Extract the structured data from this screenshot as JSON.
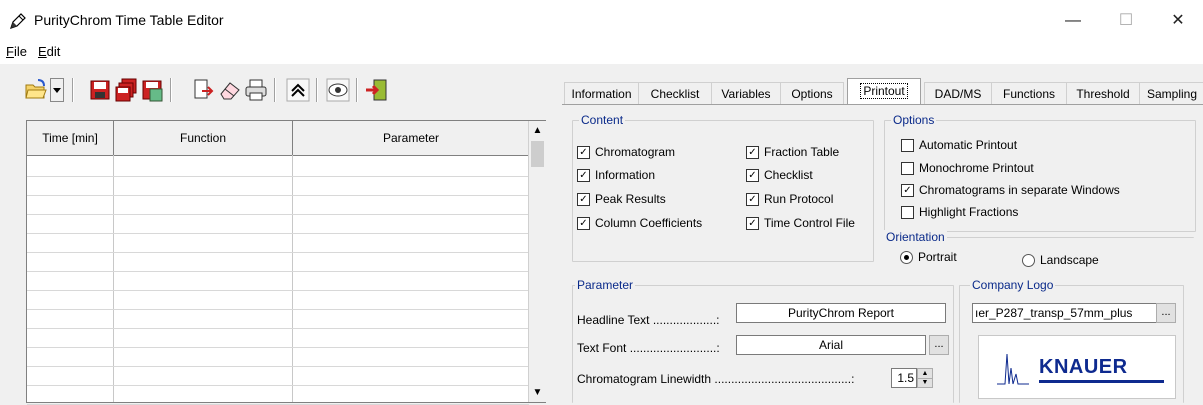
{
  "window": {
    "title": "PurityChrom Time Table Editor",
    "controls": {
      "minimize": "—",
      "maximize": "☐",
      "close": "✕"
    }
  },
  "menu": {
    "file": "File",
    "file_access": "F",
    "file_rest": "ile",
    "edit": "Edit",
    "edit_access": "E",
    "edit_rest": "dit"
  },
  "toolbar": {
    "icons": [
      "open-folder-icon",
      "dropdown-arrow-icon",
      "save-icon",
      "save-all-icon",
      "save-as-icon",
      "import-icon",
      "erase-icon",
      "print-icon",
      "move-up-icon",
      "preview-icon",
      "exit-icon"
    ]
  },
  "table": {
    "columns": [
      "Time [min]",
      "Function",
      "Parameter"
    ],
    "rows": 13
  },
  "tabs": [
    "Information",
    "Checklist",
    "Variables",
    "Options",
    "Printout",
    "DAD/MS",
    "Functions",
    "Threshold",
    "Sampling"
  ],
  "active_tab": "Printout",
  "content": {
    "label": "Content",
    "items": [
      {
        "label": "Chromatogram",
        "checked": true
      },
      {
        "label": "Information",
        "checked": true
      },
      {
        "label": "Peak Results",
        "checked": true
      },
      {
        "label": "Column Coefficients",
        "checked": true
      },
      {
        "label": "Fraction Table",
        "checked": true
      },
      {
        "label": "Checklist",
        "checked": true
      },
      {
        "label": "Run Protocol",
        "checked": true
      },
      {
        "label": "Time Control File",
        "checked": true
      }
    ]
  },
  "options": {
    "label": "Options",
    "items": [
      {
        "label": "Automatic Printout",
        "checked": false
      },
      {
        "label": "Monochrome Printout",
        "checked": false
      },
      {
        "label": "Chromatograms in separate Windows",
        "checked": true
      },
      {
        "label": "Highlight Fractions",
        "checked": false
      }
    ],
    "orientation": {
      "label": "Orientation",
      "portrait": "Portrait",
      "landscape": "Landscape",
      "selected": "Portrait"
    }
  },
  "parameter": {
    "label": "Parameter",
    "headline_label": "Headline Text ...................:",
    "headline_value": "PurityChrom Report",
    "font_label": "Text Font ..........................:",
    "font_value": "Arial",
    "linewidth_label": "Chromatogram Linewidth .........................................:",
    "linewidth_value": "1.5",
    "ellipsis": "..."
  },
  "logo": {
    "label": "Company Logo",
    "path": "ıer_P287_transp_57mm_plus",
    "ellipsis": "...",
    "brand": "KNAUER"
  },
  "check_mark": "✓"
}
